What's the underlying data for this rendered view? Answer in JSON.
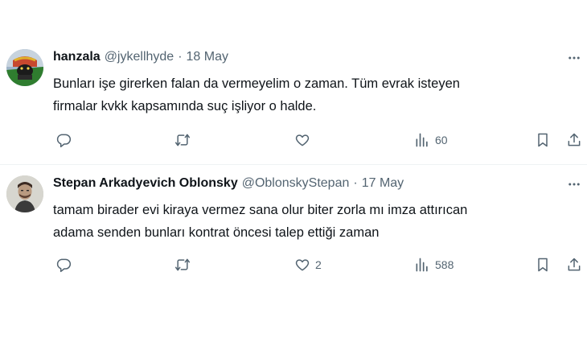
{
  "tweets": [
    {
      "name": "hanzala",
      "handle": "@jykellhyde",
      "separator": "·",
      "date": "18 May",
      "text_lines": [
        "Bunları işe girerken falan da vermeyelim o zaman. Tüm evrak isteyen",
        "firmalar kvkk kapsamında suç işliyor o halde."
      ],
      "reply_count": "",
      "retweet_count": "",
      "like_count": "",
      "view_count": "60",
      "icons": [
        "more-icon",
        "reply-icon",
        "retweet-icon",
        "like-icon",
        "views-icon",
        "bookmark-icon",
        "share-icon"
      ]
    },
    {
      "name": "Stepan Arkadyevich Oblonsky",
      "handle": "@OblonskyStepan",
      "separator": "·",
      "date": "17 May",
      "text_lines": [
        "tamam birader evi kiraya vermez sana olur biter zorla mı imza attırıcan",
        "adama senden bunları kontrat öncesi talep ettiği zaman"
      ],
      "reply_count": "",
      "retweet_count": "",
      "like_count": "2",
      "view_count": "588",
      "icons": [
        "more-icon",
        "reply-icon",
        "retweet-icon",
        "like-icon",
        "views-icon",
        "bookmark-icon",
        "share-icon"
      ]
    }
  ],
  "colors": {
    "text_primary": "#0f1419",
    "text_secondary": "#536471",
    "divider": "#eff3f4",
    "background": "#ffffff"
  }
}
